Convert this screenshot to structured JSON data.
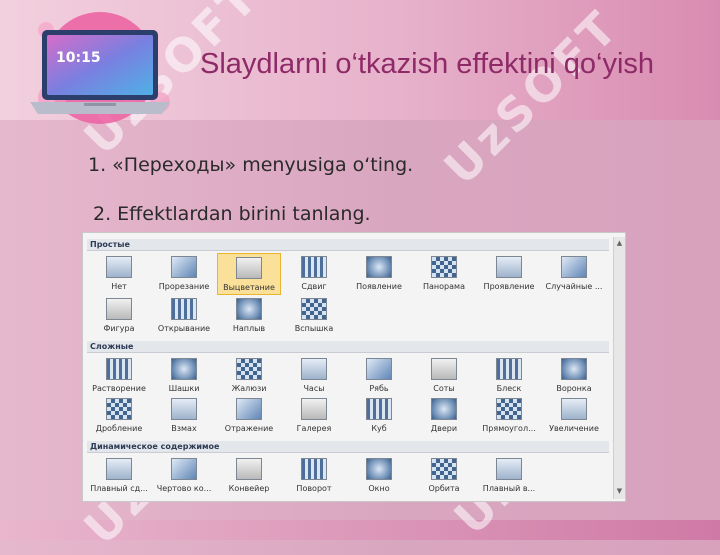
{
  "slide": {
    "title": "Slaydlarni o‘tkazish effektini qo‘yish",
    "step1": "1. «Переходы» menyusiga o‘ting.",
    "step2": "2. Effektlardan birini tanlang."
  },
  "logo": {
    "time": "10:15"
  },
  "watermark": "UzSOFT",
  "gallery": {
    "sections": [
      {
        "label": "Простые",
        "items": [
          {
            "label": "Нет",
            "icon": "none-icon"
          },
          {
            "label": "Прорезание",
            "icon": "cut-icon"
          },
          {
            "label": "Выцветание",
            "icon": "fade-icon",
            "selected": true
          },
          {
            "label": "Сдвиг",
            "icon": "push-icon"
          },
          {
            "label": "Появление",
            "icon": "wipe-icon"
          },
          {
            "label": "Панорама",
            "icon": "split-icon"
          },
          {
            "label": "Проявление",
            "icon": "reveal-icon"
          },
          {
            "label": "Случайные ...",
            "icon": "random-bars-icon"
          },
          {
            "label": "Фигура",
            "icon": "shape-icon"
          },
          {
            "label": "Открывание",
            "icon": "uncover-icon"
          },
          {
            "label": "Наплыв",
            "icon": "cover-icon"
          },
          {
            "label": "Вспышка",
            "icon": "flash-icon"
          }
        ]
      },
      {
        "label": "Сложные",
        "items": [
          {
            "label": "Растворение",
            "icon": "dissolve-icon"
          },
          {
            "label": "Шашки",
            "icon": "checkerboard-icon"
          },
          {
            "label": "Жалюзи",
            "icon": "blinds-icon"
          },
          {
            "label": "Часы",
            "icon": "clock-icon"
          },
          {
            "label": "Рябь",
            "icon": "ripple-icon"
          },
          {
            "label": "Соты",
            "icon": "honeycomb-icon"
          },
          {
            "label": "Блеск",
            "icon": "glitter-icon"
          },
          {
            "label": "Воронка",
            "icon": "vortex-icon"
          },
          {
            "label": "Дробление",
            "icon": "shred-icon"
          },
          {
            "label": "Взмах",
            "icon": "switch-icon"
          },
          {
            "label": "Отражение",
            "icon": "flip-icon"
          },
          {
            "label": "Галерея",
            "icon": "gallery-icon"
          },
          {
            "label": "Куб",
            "icon": "cube-icon"
          },
          {
            "label": "Двери",
            "icon": "doors-icon"
          },
          {
            "label": "Прямоугол...",
            "icon": "box-icon"
          },
          {
            "label": "Увеличение",
            "icon": "zoom-icon"
          }
        ]
      },
      {
        "label": "Динамическое содержимое",
        "items": [
          {
            "label": "Плавный сд...",
            "icon": "pan-icon"
          },
          {
            "label": "Чертово ко...",
            "icon": "ferris-wheel-icon"
          },
          {
            "label": "Конвейер",
            "icon": "conveyor-icon"
          },
          {
            "label": "Поворот",
            "icon": "rotate-icon"
          },
          {
            "label": "Окно",
            "icon": "window-icon"
          },
          {
            "label": "Орбита",
            "icon": "orbit-icon"
          },
          {
            "label": "Плавный в...",
            "icon": "fly-through-icon"
          }
        ]
      }
    ]
  }
}
